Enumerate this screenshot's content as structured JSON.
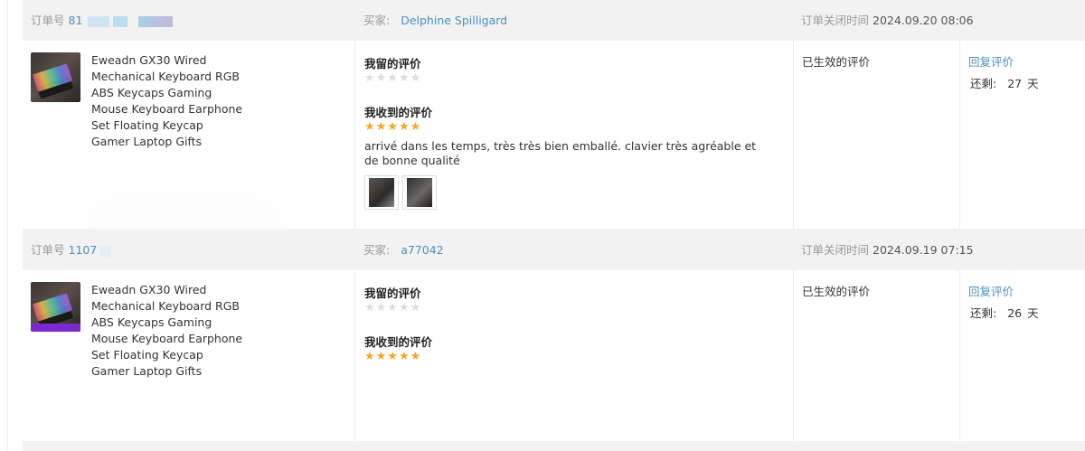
{
  "labels": {
    "order_no": "订单号",
    "buyer": "买家:",
    "close_time": "订单关闭时间",
    "my_review": "我留的评价",
    "received_review": "我收到的评价",
    "reply": "回复评价",
    "remaining": "还剩:",
    "days_unit": "天",
    "status_effective": "已生效的评价"
  },
  "stars": {
    "empty": "★★★★★",
    "full": "★★★★★"
  },
  "orders": [
    {
      "order_no_partial": "81",
      "buyer": "Delphine Spilligard",
      "close_time": "2024.09.20 08:06",
      "product_title": "Eweadn GX30 Wired Mechanical Keyboard RGB ABS Keycaps Gaming Mouse Keyboard Earphone Set Floating Keycap Gamer Laptop Gifts",
      "my_rating": 0,
      "received_rating": 5,
      "received_text": "arrivé dans les temps, très très bien emballé. clavier très agréable et de bonne qualité",
      "photos": [
        "keyboard-photo",
        "keyboard-photo"
      ],
      "status": "已生效的评价",
      "remaining_days": "27"
    },
    {
      "order_no_partial": "1107",
      "buyer": "a77042",
      "close_time": "2024.09.19 07:15",
      "product_title": "Eweadn GX30 Wired Mechanical Keyboard RGB ABS Keycaps Gaming Mouse Keyboard Earphone Set Floating Keycap Gamer Laptop Gifts",
      "my_rating": 0,
      "received_rating": 5,
      "received_text": "",
      "photos": [],
      "status": "已生效的评价",
      "remaining_days": "26"
    }
  ],
  "colors": {
    "link": "#4a90c2",
    "star": "#f5a623",
    "header_bg": "#f2f2f2"
  }
}
